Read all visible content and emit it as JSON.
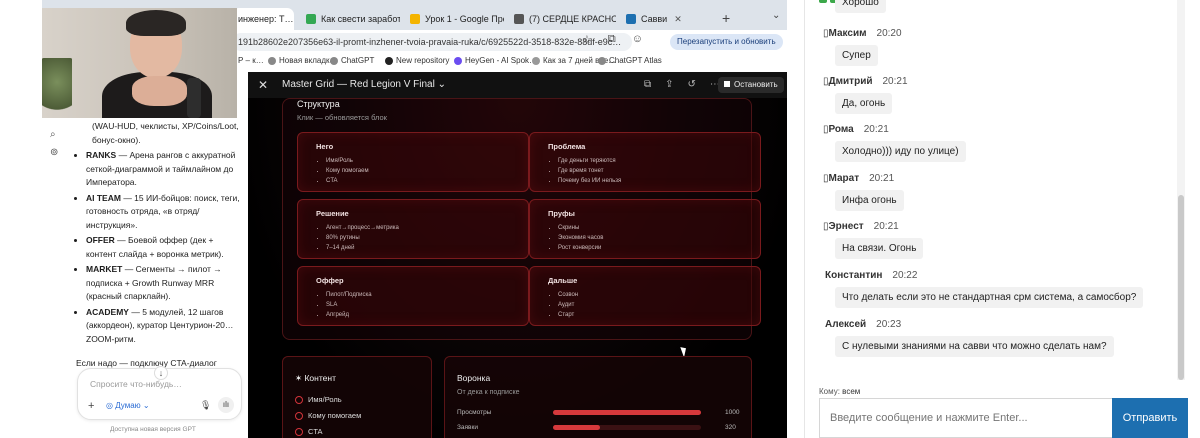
{
  "browser": {
    "tabs": [
      {
        "label": "инженер: Т…",
        "icon_color": "#8a5"
      },
      {
        "label": "Как свести заработок…",
        "icon_color": "#34a853"
      },
      {
        "label": "Урок 1 - Google Презе…",
        "icon_color": "#f4b400"
      },
      {
        "label": "(7) СЕРДЦЕ КРАСНОГ…",
        "icon_color": "#555"
      },
      {
        "label": "Савви",
        "icon_color": "#1d6fb0"
      }
    ],
    "url": "191b28602e207356e63-il-promt-inzhener-tvoia-pravaia-ruka/c/6925522d-3518-832e-88df-e9c…",
    "relaunch_label": "Перезапустить и обновить",
    "bookmarks": [
      "Р – к…",
      "Новая вкладка",
      "ChatGPT",
      "New repository",
      "HeyGen - AI Spok…",
      "Как за 7 дней вне…",
      "ChatGPT Atlas"
    ]
  },
  "gpt": {
    "intro": "(WAU-HUD, чеклисты, XP/Coins/Loot, бонус-окно).",
    "items": [
      {
        "bold": "RANKS",
        "text": " — Арена рангов с аккуратной сеткой-диаграммой и таймлайном до Императора."
      },
      {
        "bold": "AI TEAM",
        "text": " — 15 ИИ-бойцов: поиск, теги, готовность отряда, «в отряд/инструкция»."
      },
      {
        "bold": "OFFER",
        "text": " — Боевой оффер (дек + контент слайда + воронка метрик)."
      },
      {
        "bold": "MARKET",
        "text": " — Сегменты → пилот → подписка + Growth Runway MRR (красный спарклайн)."
      },
      {
        "bold": "ACADEMY",
        "text": " — 5 модулей, 12 шагов (аккордеон), куратор Центурион-20… ZOOM-ритм."
      }
    ],
    "tail": "Если надо — подключу CTA-диалог",
    "composer_placeholder": "Спросите что-нибудь…",
    "think_label": "Думаю",
    "footer": "Доступна новая версия GPT"
  },
  "viewer": {
    "title": "Master Grid — Red Legion V Final",
    "stop_label": "Остановить",
    "panel_title": "Структура",
    "panel_sub": "Клик — обновляется блок",
    "cards": [
      {
        "title": "Него",
        "items": [
          "Имя/Роль",
          "Кому помогаем",
          "CTA"
        ]
      },
      {
        "title": "Проблема",
        "items": [
          "Где деньги теряются",
          "Где время тонет",
          "Почему без ИИ нельзя"
        ]
      },
      {
        "title": "Решение",
        "items": [
          "Агент→процесс→метрика",
          "80% рутины",
          "7–14 дней"
        ]
      },
      {
        "title": "Пруфы",
        "items": [
          "Скрины",
          "Экономия часов",
          "Рост конверсии"
        ]
      },
      {
        "title": "Оффер",
        "items": [
          "Пилот/Подписка",
          "SLA",
          "Апгрейд"
        ]
      },
      {
        "title": "Дальше",
        "items": [
          "Созвон",
          "Аудит",
          "Старт"
        ]
      }
    ],
    "content_box": {
      "title": "Контент",
      "items": [
        "Имя/Роль",
        "Кому помогаем",
        "CTA"
      ]
    },
    "funnel_box": {
      "title": "Воронка",
      "subtitle": "От дека к подписке",
      "rows": [
        {
          "label": "Просмотры",
          "value": "1000",
          "fraction": 1.0
        },
        {
          "label": "Заявки",
          "value": "320",
          "fraction": 0.32
        }
      ]
    }
  },
  "chat": {
    "top_bubble": "Хорошо",
    "messages": [
      {
        "name": "Максим",
        "time": "20:20",
        "text": "Супер",
        "marker": "▯"
      },
      {
        "name": "Дмитрий",
        "time": "20:21",
        "text": "Да, огонь",
        "marker": "▯"
      },
      {
        "name": "Рома",
        "time": "20:21",
        "text": "Холодно))) иду по улице)",
        "marker": "▯"
      },
      {
        "name": "Марат",
        "time": "20:21",
        "text": "Инфа огонь",
        "marker": "▯"
      },
      {
        "name": "Эрнест",
        "time": "20:21",
        "text": "На связи. Огонь",
        "marker": "▯"
      },
      {
        "name": "Константин",
        "time": "20:22",
        "text": "Что делать если это не стандартная срм система, а самосбор?",
        "marker": ""
      },
      {
        "name": "Алексей",
        "time": "20:23",
        "text": "С нулевыми знаниями на савви что можно сделать нам?",
        "marker": ""
      }
    ],
    "to_label": "Кому:",
    "to_value": "всем",
    "input_placeholder": "Введите сообщение и нажмите Enter...",
    "send_label": "Отправить"
  }
}
